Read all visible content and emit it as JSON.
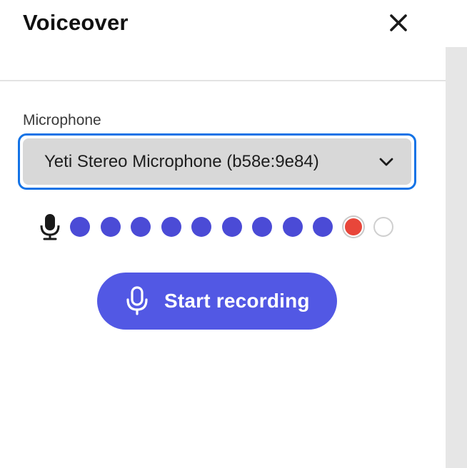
{
  "panel": {
    "title": "Voiceover",
    "close_icon": "close-icon"
  },
  "microphone": {
    "label": "Microphone",
    "selected": "Yeti Stereo Microphone (b58e:9e84)",
    "dropdown_icon": "chevron-down-icon"
  },
  "level_meter": {
    "icon": "microphone-icon",
    "segments": [
      "on",
      "on",
      "on",
      "on",
      "on",
      "on",
      "on",
      "on",
      "on",
      "peak",
      "off"
    ],
    "colors": {
      "on": "#4b4bd6",
      "peak": "#e8463a",
      "off": "#ffffff"
    }
  },
  "record_button": {
    "label": "Start recording",
    "icon": "microphone-outline-icon",
    "color": "#5258e4"
  },
  "colors": {
    "focus_ring": "#1473e6",
    "select_bg": "#d8d8d8"
  }
}
